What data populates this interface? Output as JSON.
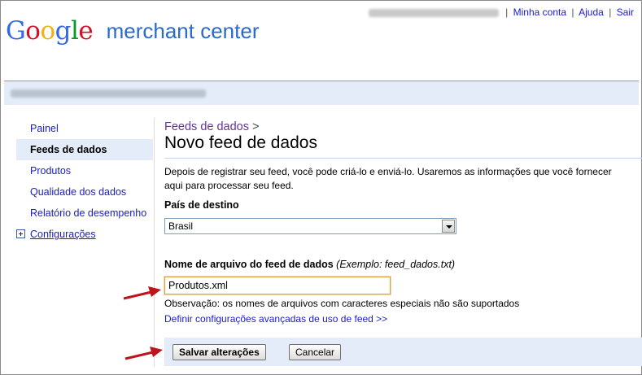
{
  "header": {
    "email_link": "",
    "separator": "|",
    "my_account": "Minha conta",
    "help": "Ajuda",
    "sign_out": "Sair"
  },
  "logo": {
    "google_letters": [
      "G",
      "o",
      "o",
      "g",
      "l",
      "e"
    ],
    "google_colors": [
      "#3369e8",
      "#d50f25",
      "#eeb211",
      "#3369e8",
      "#009925",
      "#d50f25"
    ],
    "product": "merchant center"
  },
  "sidebar": {
    "items": [
      {
        "label": "Painel",
        "active": false
      },
      {
        "label": "Feeds de dados",
        "active": true
      },
      {
        "label": "Produtos",
        "active": false
      },
      {
        "label": "Qualidade dos dados",
        "active": false
      },
      {
        "label": "Relatório de desempenho",
        "active": false
      },
      {
        "label": "Configurações",
        "active": false,
        "icon": "plus-box-icon"
      }
    ]
  },
  "main": {
    "breadcrumb_link": "Feeds de dados",
    "breadcrumb_sep": ">",
    "title": "Novo feed de dados",
    "description_line1": "Depois de registrar seu feed, você pode criá-lo e enviá-lo. Usaremos as informações que você fornecer",
    "description_line2": "aqui para processar seu feed.",
    "country_label": "País de destino",
    "country_value": "Brasil",
    "filename_label": "Nome de arquivo do feed de dados",
    "filename_hint": "(Exemplo: feed_dados.txt)",
    "filename_value": "Produtos.xml",
    "note": "Observação: os nomes de arquivos com caracteres especiais não são suportados",
    "advanced_link": "Definir configurações avançadas de uso de feed >>",
    "save_button": "Salvar alterações",
    "cancel_button": "Cancelar"
  },
  "colors": {
    "link": "#1a1ad0",
    "visited_link": "#663399",
    "highlight_bg": "#e5ecf9",
    "arrow": "#c0141c"
  }
}
